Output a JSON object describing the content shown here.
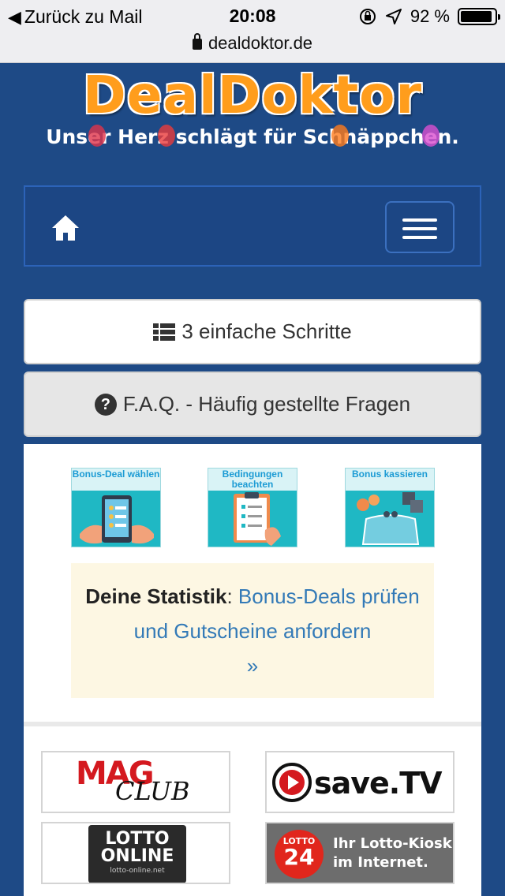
{
  "status_bar": {
    "back_label": "Zurück zu Mail",
    "time": "20:08",
    "battery": "92 %",
    "battery_level": 0.92,
    "url": "dealdoktor.de"
  },
  "logo": {
    "title": "DealDoktor",
    "tagline": "Unser Herz schlägt für Schnäppchen."
  },
  "buttons": {
    "steps_label": "3 einfache Schritte",
    "faq_label": "F.A.Q. - Häufig gestellte Fragen"
  },
  "steps": [
    {
      "label": "Bonus-Deal wählen"
    },
    {
      "label": "Bedingungen beachten"
    },
    {
      "label": "Bonus kassieren"
    }
  ],
  "stats": {
    "prefix": "Deine Statistik",
    "separator": ":",
    "link": "Bonus-Deals prüfen und Gutscheine anfordern",
    "arrow": "»"
  },
  "sponsors": {
    "mag_club": {
      "mag": "MAG",
      "club": "CLUB"
    },
    "save_tv": {
      "text": "save.TV"
    },
    "lotto_online": {
      "line1": "LOTTO",
      "line2": "ONLINE",
      "domain": "lotto-online.net"
    },
    "lotto24": {
      "badge_top": "LOTTO",
      "badge_num": "24",
      "line1": "Ihr Lotto-Kiosk",
      "line2": "im Internet."
    }
  },
  "colors": {
    "page_bg": "#1e4a86",
    "navbar": "#1c4684",
    "link": "#337ab7",
    "logo_orange": "#ff9d1c",
    "step_teal": "#1fb8c4",
    "stat_bg": "#fdf7e3"
  }
}
